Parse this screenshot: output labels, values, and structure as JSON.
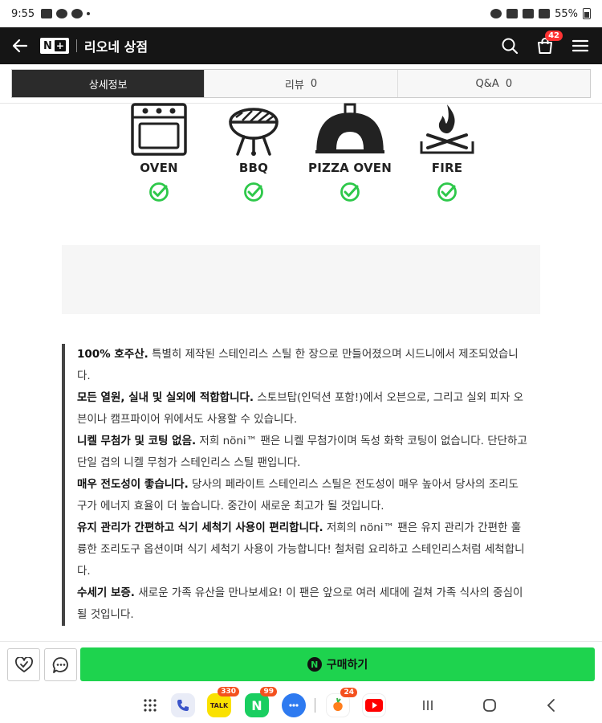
{
  "status_bar": {
    "time": "9:55",
    "battery": "55%"
  },
  "header": {
    "logo_text": "N",
    "logo_plus": "+",
    "store_name": "리오네 상점",
    "cart_count": "42"
  },
  "tabs": [
    {
      "label": "상세정보",
      "count": ""
    },
    {
      "label": "리뷰",
      "count": "0"
    },
    {
      "label": "Q&A",
      "count": "0"
    }
  ],
  "cooking_methods": [
    {
      "label": "OVEN",
      "icon": "oven-icon"
    },
    {
      "label": "BBQ",
      "icon": "bbq-grill-icon"
    },
    {
      "label": "PIZZA OVEN",
      "icon": "pizza-oven-icon"
    },
    {
      "label": "FIRE",
      "icon": "campfire-icon"
    }
  ],
  "check_color": "#2ec84a",
  "description": [
    {
      "bold": "100% 호주산.",
      "text": " 특별히 제작된 스테인리스 스틸 한 장으로 만들어졌으며 시드니에서 제조되었습니다."
    },
    {
      "bold": "모든 열원, 실내 및 실외에 적합합니다.",
      "text": "  스토브탑(인덕션 포함!)에서 오븐으로, 그리고 실외 피자 오븐이나 캠프파이어 위에서도 사용할 수 있습니다."
    },
    {
      "bold": "니켈 무첨가 및 코팅 없음.",
      "text": "  저희 nöni™ 팬은 니켈 무첨가이며 독성 화학 코팅이 없습니다. 단단하고 단일 겹의 니켈 무첨가 스테인리스 스틸 팬입니다."
    },
    {
      "bold": "매우 전도성이 좋습니다.",
      "text": " 당사의 페라이트 스테인리스 스틸은 전도성이 매우 높아서 당사의 조리도구가 에너지 효율이 더 높습니다. 중간이 새로운 최고가 될 것입니다."
    },
    {
      "bold": "유지 관리가 간편하고 식기 세척기 사용이 편리합니다.",
      "text": "  저희의 nöni™ 팬은 유지 관리가 간편한 훌륭한 조리도구 옵션이며 식기 세척기 사용이 가능합니다! 철처럼 요리하고 스테인리스처럼 세척합니다."
    },
    {
      "bold": "수세기 보증.",
      "text": " 새로운 가족 유산을 만나보세요! 이 팬은 앞으로 여러 세대에 걸쳐 가족 식사의 중심이 될 것입니다."
    }
  ],
  "bottom_bar": {
    "buy_label": "구매하기",
    "buy_icon_letter": "N",
    "buy_color": "#1ed34e"
  },
  "navbar": {
    "apps": [
      {
        "name": "phone",
        "badge": ""
      },
      {
        "name": "kakaotalk",
        "label": "TALK",
        "badge": "330"
      },
      {
        "name": "naver",
        "label": "N",
        "badge": "99"
      },
      {
        "name": "messages",
        "badge": ""
      },
      {
        "name": "carrot",
        "badge": "24"
      },
      {
        "name": "youtube",
        "badge": ""
      }
    ]
  }
}
